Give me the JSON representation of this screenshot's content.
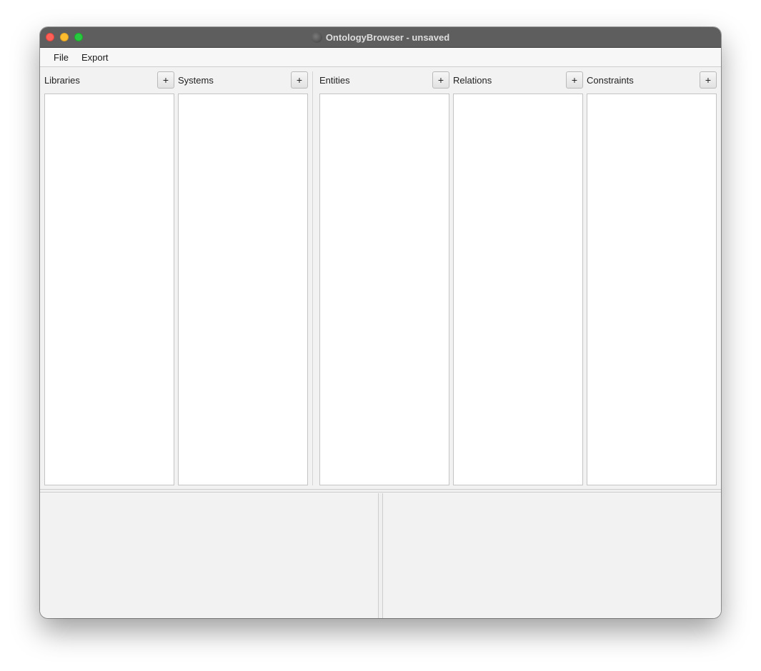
{
  "window": {
    "title": "OntologyBrowser - unsaved"
  },
  "menu": {
    "items": [
      "File",
      "Export"
    ]
  },
  "panels": [
    {
      "label": "Libraries",
      "add_label": "+"
    },
    {
      "label": "Systems",
      "add_label": "+"
    },
    {
      "label": "Entities",
      "add_label": "+"
    },
    {
      "label": "Relations",
      "add_label": "+"
    },
    {
      "label": "Constraints",
      "add_label": "+"
    }
  ],
  "colors": {
    "titlebar": "#5e5e5e",
    "close": "#fe5f57",
    "minimize": "#febc2e",
    "maximize": "#28c840"
  }
}
